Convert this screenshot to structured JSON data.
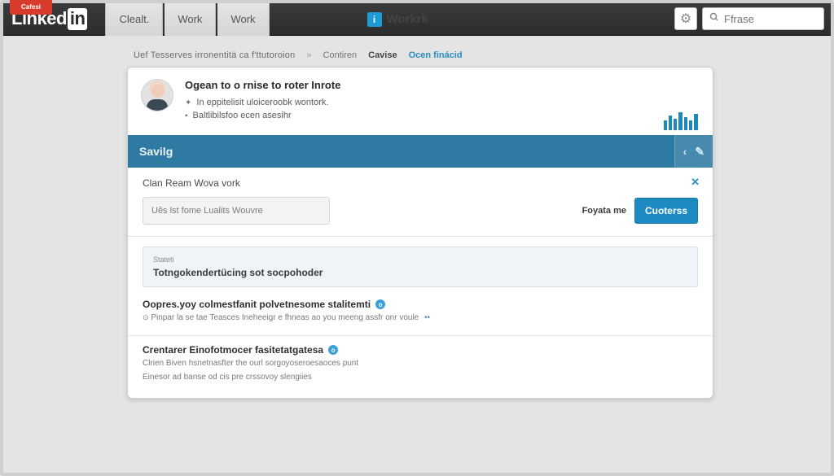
{
  "topbar": {
    "red_tab": "Cafesi",
    "logo_main": "Linked",
    "logo_in": "in",
    "nav": [
      {
        "label": "Clealt."
      },
      {
        "label": "Work"
      },
      {
        "label": "Work"
      }
    ],
    "work_badge": "i",
    "work_label": "Workrk",
    "search_placeholder": "Ffrase"
  },
  "breadcrumb": {
    "main": "Uef Tesserves irronentitä ca f'ttutoroion",
    "contrin": "Contiren",
    "cavise": "Cavise",
    "link": "Ocen finácid"
  },
  "card": {
    "header": {
      "title": "Ogean to o rnise to roter Inrote",
      "sub1": "In eppitelisit uloiceroobk wontork.",
      "sub2": "Baltlibilsfoo ecen asesihr"
    },
    "blue_bar": {
      "label": "Savilg"
    },
    "clan": {
      "title": "Clan Ream Wova vork",
      "input_placeholder": "Uês lst fome Lualits Wouvre",
      "row_label": "Foyata me",
      "button": "Cuoterss"
    },
    "flat": {
      "label": "Stateti",
      "title": "Totngokendertücing sot socpohoder"
    },
    "options": [
      {
        "title": "Oopres.yoy colmestfanit polvetnesome stalitemti",
        "desc": "Pinpar la se tae Teasces Ineheeigr e fhneas ao you meeng assfr onr voule"
      },
      {
        "title": "Crentarer Einofotmocer fasitetatgatesa",
        "desc1": "Clrien Biven hsnetnasfter the ourl sorgoyoseroesaoces punt",
        "desc2": "Einesor ad banse od cis pre crssovoy slengiies"
      }
    ]
  }
}
